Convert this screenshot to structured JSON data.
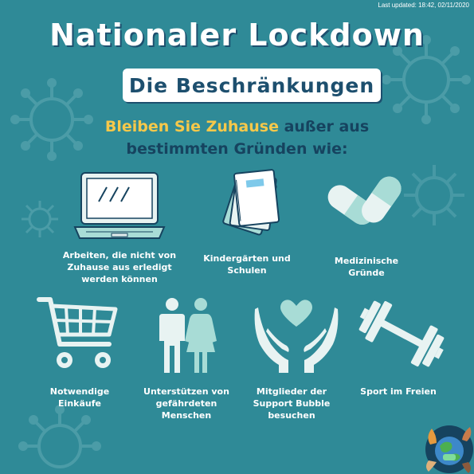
{
  "last_updated": "Last updated: 18:42, 02/11/2020",
  "title": "Nationaler Lockdown",
  "subtitle": "Die Beschränkungen",
  "intro": {
    "highlight": "Bleiben Sie Zuhause",
    "rest_line1": " außer aus",
    "line2": "bestimmten Gründen wie:"
  },
  "items": [
    {
      "label_lines": [
        "Arbeiten, die nicht von",
        "Zuhause aus erledigt",
        "werden können"
      ],
      "icon": "laptop-icon"
    },
    {
      "label_lines": [
        "Kindergärten und",
        "Schulen"
      ],
      "icon": "notebooks-icon"
    },
    {
      "label_lines": [
        "Medizinische",
        "Gründe"
      ],
      "icon": "pills-icon"
    },
    {
      "label_lines": [
        "Notwendige",
        "Einkäufe"
      ],
      "icon": "shopping-cart-icon"
    },
    {
      "label_lines": [
        "Unterstützen von",
        "gefährdeten",
        "Menschen"
      ],
      "icon": "people-icon"
    },
    {
      "label_lines": [
        "Mitglieder der",
        "Support Bubble",
        "besuchen"
      ],
      "icon": "hands-heart-icon"
    },
    {
      "label_lines": [
        "Sport im Freien"
      ],
      "icon": "dumbbell-icon"
    }
  ],
  "colors": {
    "background": "#2f8a97",
    "dark_navy": "#16435f",
    "highlight_yellow": "#f6c84a",
    "icon_light": "#e8f3f2",
    "icon_teal": "#a8dcd6"
  }
}
